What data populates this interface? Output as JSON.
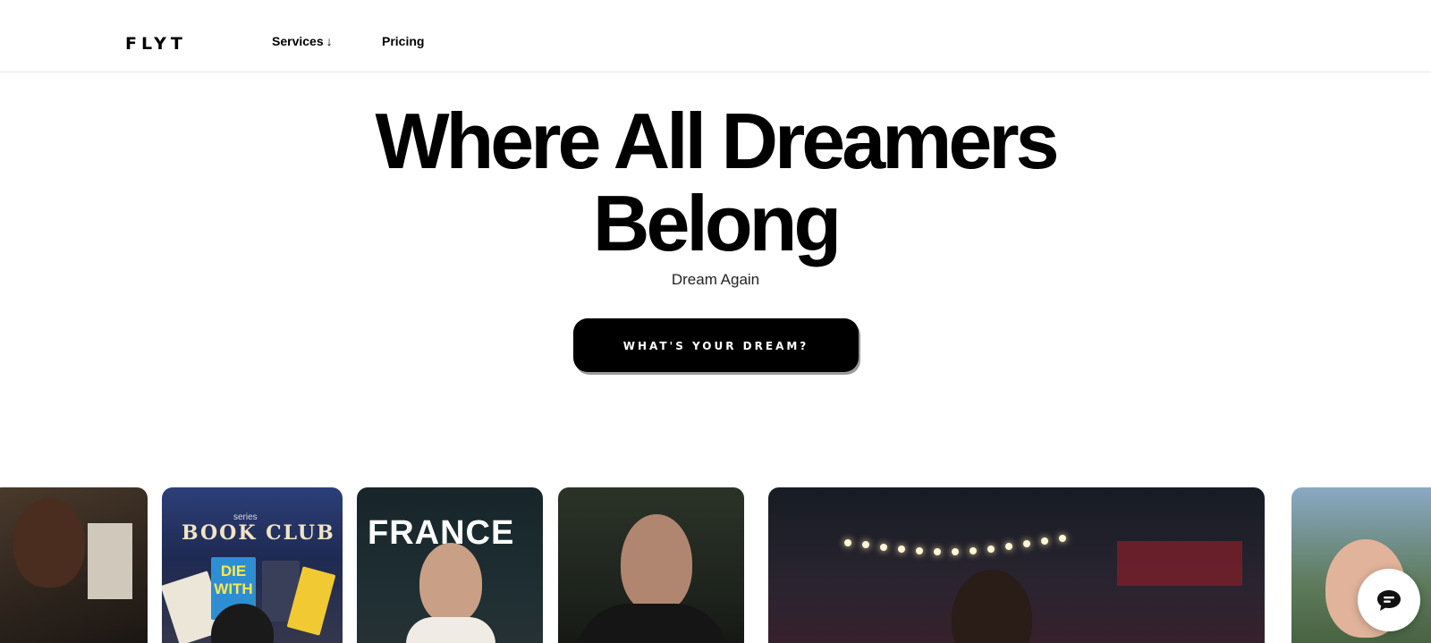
{
  "header": {
    "logo": "FLYT",
    "nav": [
      {
        "label": "Services",
        "icon": "arrow-down-icon",
        "arrow": "↓"
      },
      {
        "label": "Pricing"
      }
    ]
  },
  "hero": {
    "title_line1": "Where All Dreamers",
    "title_line2": "Belong",
    "subtitle": "Dream Again",
    "cta_label": "WHAT'S YOUR DREAM?"
  },
  "gallery": {
    "cards": [
      {
        "name": "video-card-1"
      },
      {
        "name": "video-card-2",
        "series_text": "series",
        "title_text": "BOOK CLUB",
        "book_text": "DIE WITH"
      },
      {
        "name": "video-card-3",
        "overlay_text": "FRANCE"
      },
      {
        "name": "video-card-4"
      },
      {
        "name": "video-card-5"
      },
      {
        "name": "video-card-6"
      }
    ]
  },
  "chat": {
    "icon": "chat-icon"
  },
  "colors": {
    "background": "#ffffff",
    "text": "#000000",
    "cta_background": "#000000",
    "cta_text": "#ffffff"
  }
}
